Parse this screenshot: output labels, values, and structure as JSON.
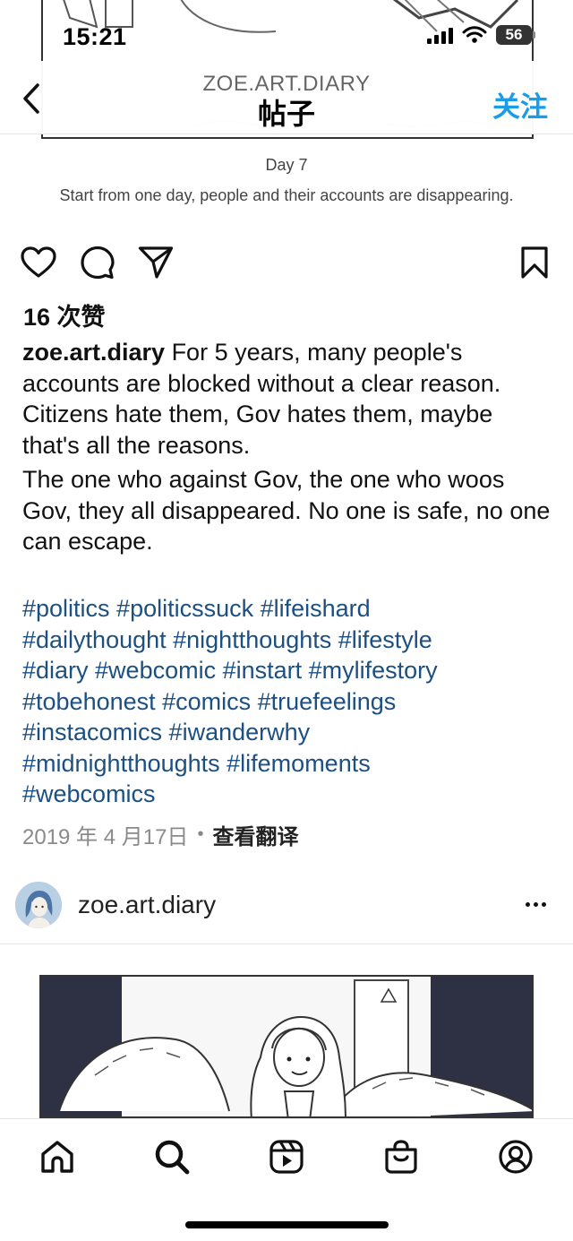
{
  "status_bar": {
    "time": "15:21",
    "battery": "56"
  },
  "header": {
    "subtitle": "ZOE.ART.DIARY",
    "title": "帖子",
    "follow_label": "关注"
  },
  "comic": {
    "day_label": "Day 7",
    "description": "Start from one day, people and their accounts are disappearing."
  },
  "post": {
    "likes": "16 次赞",
    "username": "zoe.art.diary",
    "caption_first": " For 5 years, many people's accounts are blocked without a clear reason. Citizens hate them, Gov hates them, maybe that's all the reasons.",
    "caption_second": "The one who against Gov, the one who woos Gov, they all disappeared. No one is safe, no one can escape.",
    "hashtag_lines": [
      "#politics #politicssuck #lifeishard",
      "#dailythought #nightthoughts #lifestyle",
      "#diary #webcomic #instart #mylifestory",
      "#tobehonest #comics #truefeelings",
      "#instacomics #iwanderwhy",
      "#midnightthoughts #lifemoments",
      "#webcomics"
    ],
    "date": "2019 年 4 月17日",
    "translate_label": "查看翻译"
  },
  "next_post": {
    "username": "zoe.art.diary"
  },
  "icons": {
    "back": "chevron-left-icon",
    "like": "heart-icon",
    "comment": "comment-icon",
    "share": "send-icon",
    "save": "bookmark-icon",
    "more": "more-icon",
    "tabs": [
      "home-icon",
      "search-icon",
      "reels-icon",
      "shop-icon",
      "profile-icon"
    ]
  },
  "colors": {
    "accent": "#1a9ce8",
    "hashtag": "#1c4f82",
    "meta": "#8a8a8a"
  }
}
